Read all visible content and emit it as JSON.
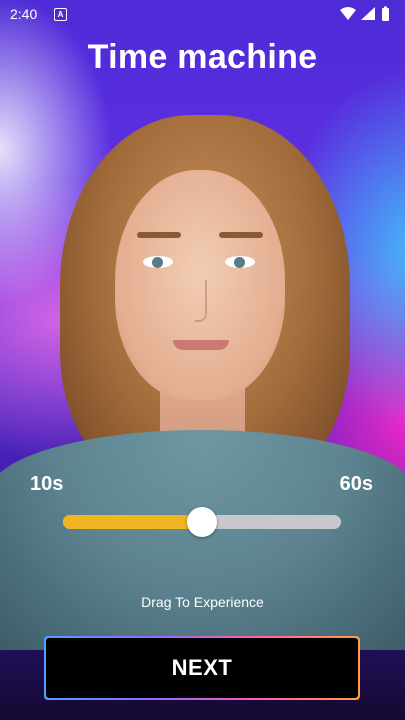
{
  "status_bar": {
    "time": "2:40",
    "notification_badge": "A",
    "icons": [
      "wifi-icon",
      "signal-icon",
      "battery-icon"
    ]
  },
  "title": "Time machine",
  "slider": {
    "min_label": "10s",
    "max_label": "60s",
    "value_fraction": 0.5,
    "fill_color": "#f3b421",
    "track_color": "#c8c8cc"
  },
  "hint": "Drag To Experience",
  "next_button": {
    "label": "NEXT"
  }
}
